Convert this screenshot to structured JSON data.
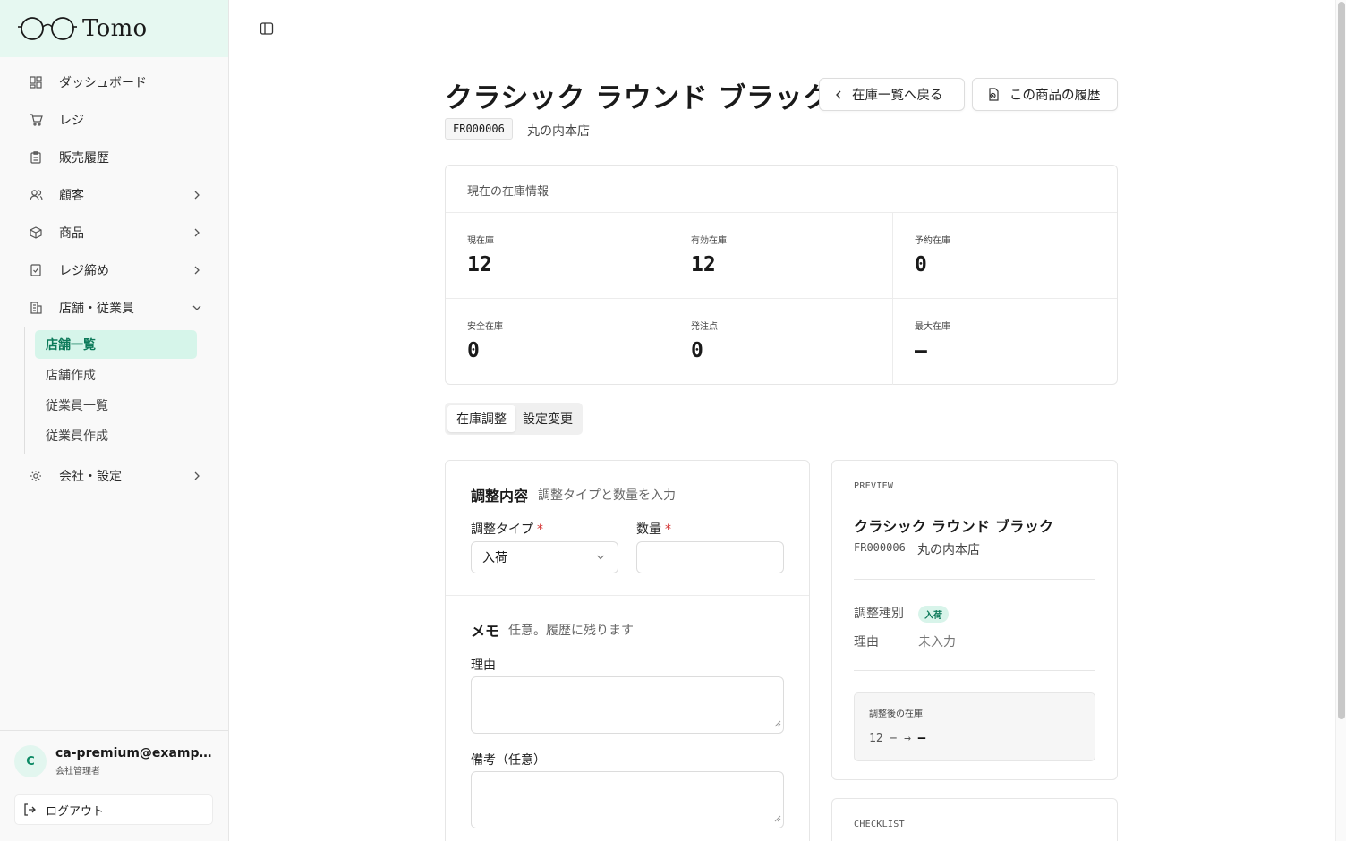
{
  "app": {
    "name": "Tomo"
  },
  "sidebar": {
    "items": [
      {
        "label": "ダッシュボード",
        "icon": "dashboard-icon"
      },
      {
        "label": "レジ",
        "icon": "cart-icon"
      },
      {
        "label": "販売履歴",
        "icon": "clipboard-icon"
      },
      {
        "label": "顧客",
        "icon": "users-icon",
        "expandable": true
      },
      {
        "label": "商品",
        "icon": "box-icon",
        "expandable": true
      },
      {
        "label": "レジ締め",
        "icon": "checklist-icon",
        "expandable": true
      },
      {
        "label": "店舗・従業員",
        "icon": "building-icon",
        "expanded": true
      },
      {
        "label": "会社・設定",
        "icon": "gear-icon",
        "expandable": true
      }
    ],
    "sub_items": [
      {
        "label": "店舗一覧",
        "active": true
      },
      {
        "label": "店舗作成"
      },
      {
        "label": "従業員一覧"
      },
      {
        "label": "従業員作成"
      }
    ],
    "user": {
      "initial": "C",
      "email": "ca-premium@example.com",
      "role": "会社管理者"
    },
    "logout_label": "ログアウト"
  },
  "header": {
    "title": "クラシック ラウンド ブラック",
    "code": "FR000006",
    "store": "丸の内本店",
    "back_label": "在庫一覧へ戻る",
    "history_label": "この商品の履歴"
  },
  "stock": {
    "heading": "現在の在庫情報",
    "cells": [
      {
        "label": "現在庫",
        "value": "12"
      },
      {
        "label": "有効在庫",
        "value": "12"
      },
      {
        "label": "予約在庫",
        "value": "0"
      },
      {
        "label": "安全在庫",
        "value": "0"
      },
      {
        "label": "発注点",
        "value": "0"
      },
      {
        "label": "最大在庫",
        "value": "—"
      }
    ]
  },
  "tabs": [
    {
      "label": "在庫調整",
      "active": true
    },
    {
      "label": "設定変更"
    }
  ],
  "form": {
    "adjust_title": "調整内容",
    "adjust_desc": "調整タイプと数量を入力",
    "type_label": "調整タイプ",
    "type_value": "入荷",
    "qty_label": "数量",
    "required_mark": "*",
    "memo_title": "メモ",
    "memo_desc": "任意。履歴に残ります",
    "reason_label": "理由",
    "note_label": "備考（任意）"
  },
  "preview": {
    "label": "PREVIEW",
    "name": "クラシック ラウンド ブラック",
    "code": "FR000006",
    "store": "丸の内本店",
    "type_key": "調整種別",
    "type_badge": "入荷",
    "reason_key": "理由",
    "reason_value": "未入力",
    "after_label": "調整後の在庫",
    "after_from": "12 − → ",
    "after_to": "—"
  },
  "checklist": {
    "label": "CHECKLIST"
  },
  "colors": {
    "accent": "#0d7a5a",
    "accent_bg": "#d6f5ea",
    "brand_bg": "#e6f8f1",
    "required": "#d32f2f"
  }
}
